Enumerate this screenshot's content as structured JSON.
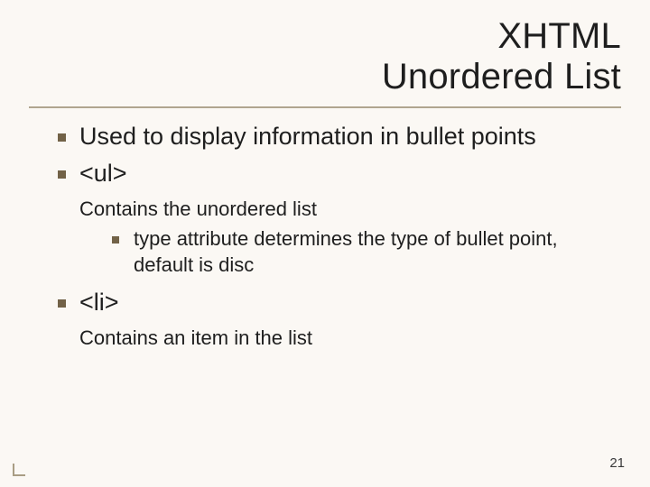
{
  "title_line1": "XHTML",
  "title_line2": "Unordered List",
  "bullets": {
    "b0": "Used to display information in bullet points",
    "b1": "<ul>",
    "b1_sub": "Contains the unordered list",
    "b1_sub_b0": "type attribute determines the type of bullet point, default is disc",
    "b2": "<li>",
    "b2_sub": "Contains an item in the list"
  },
  "page_number": "21"
}
